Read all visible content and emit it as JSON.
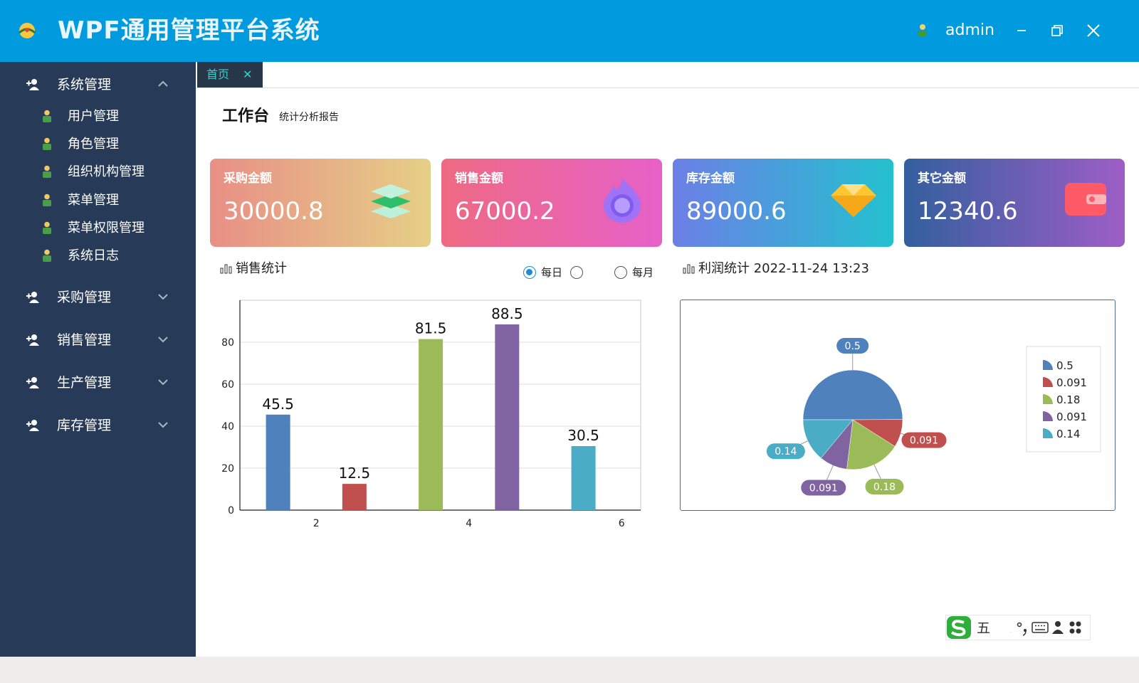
{
  "app": {
    "title": "WPF通用管理平台系统",
    "username": "admin"
  },
  "window_controls": {
    "minimize": "minimize",
    "restore": "restore",
    "close": "close"
  },
  "sidebar": {
    "groups": [
      {
        "label": "系统管理",
        "expanded": true,
        "items": [
          "用户管理",
          "角色管理",
          "组织机构管理",
          "菜单管理",
          "菜单权限管理",
          "系统日志"
        ]
      },
      {
        "label": "采购管理",
        "expanded": false
      },
      {
        "label": "销售管理",
        "expanded": false
      },
      {
        "label": "生产管理",
        "expanded": false
      },
      {
        "label": "库存管理",
        "expanded": false
      }
    ]
  },
  "tabs": [
    {
      "label": "首页",
      "close": "✕"
    }
  ],
  "workspace": {
    "title": "工作台",
    "subtitle": "统计分析报告"
  },
  "cards": [
    {
      "label": "采购金额",
      "value": "30000.8",
      "icon": "layers-icon",
      "gradient": [
        "#e88f86",
        "#e5cf86"
      ]
    },
    {
      "label": "销售金额",
      "value": "67000.2",
      "icon": "flame-icon",
      "gradient": [
        "#ee6a83",
        "#e660c8"
      ]
    },
    {
      "label": "库存金额",
      "value": "89000.6",
      "icon": "diamond-icon",
      "gradient": [
        "#6c7fe6",
        "#23c1cf"
      ]
    },
    {
      "label": "其它金额",
      "value": "12340.6",
      "icon": "wallet-icon",
      "gradient": [
        "#335f9e",
        "#9e5ec6"
      ]
    }
  ],
  "sales": {
    "title": "销售统计",
    "radios": [
      {
        "label": "每日",
        "checked": true
      },
      {
        "label": "",
        "checked": false
      },
      {
        "label": "每月",
        "checked": false
      }
    ]
  },
  "profit": {
    "title": "利润统计",
    "timestamp": "2022-11-24 13:23"
  },
  "chart_data": [
    {
      "type": "bar",
      "x": [
        1.5,
        2.5,
        3.5,
        4.5,
        5.5
      ],
      "values": [
        45.5,
        12.5,
        81.5,
        88.5,
        30.5
      ],
      "data_labels": [
        "45.5",
        "12.5",
        "81.5",
        "88.5",
        "30.5"
      ],
      "colors": [
        "#4f81bd",
        "#c0504d",
        "#9bbb59",
        "#8064a2",
        "#4bacc6"
      ],
      "x_ticks": [
        2,
        4,
        6
      ],
      "y_ticks": [
        0,
        20,
        40,
        60,
        80
      ],
      "xlim": [
        1,
        6.25
      ],
      "ylim": [
        0,
        100
      ],
      "grid": true,
      "title": "",
      "xlabel": "",
      "ylabel": ""
    },
    {
      "type": "pie",
      "slices": [
        {
          "label": "0.5",
          "value": 0.5,
          "color": "#4f81bd"
        },
        {
          "label": "0.091",
          "value": 0.091,
          "color": "#c0504d"
        },
        {
          "label": "0.18",
          "value": 0.18,
          "color": "#9bbb59"
        },
        {
          "label": "0.091",
          "value": 0.091,
          "color": "#8064a2"
        },
        {
          "label": "0.14",
          "value": 0.14,
          "color": "#4bacc6"
        }
      ],
      "legend_position": "right"
    }
  ],
  "ime_toolbar": {
    "mode": "五"
  }
}
